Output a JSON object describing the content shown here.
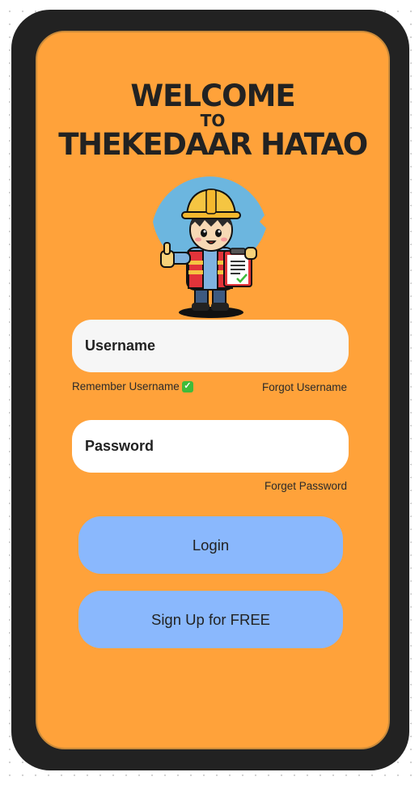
{
  "welcome": {
    "line1": "WELCOME",
    "line2": "TO",
    "line3": "THEKEDAAR HATAO"
  },
  "mascot": {
    "icon": "construction-worker-mascot-icon"
  },
  "username": {
    "placeholder": "Username"
  },
  "remember": {
    "label": "Remember Username",
    "check_glyph": "✓",
    "check_color": "#3fbb3a"
  },
  "forgot_username": "Forgot Username",
  "password": {
    "placeholder": "Password"
  },
  "forget_password": "Forget Password",
  "buttons": {
    "login": "Login",
    "signup": "Sign Up for FREE"
  },
  "colors": {
    "screen_background": "#ffa23a",
    "frame": "#222222",
    "button": "#8ab8fd",
    "text": "#222222"
  }
}
